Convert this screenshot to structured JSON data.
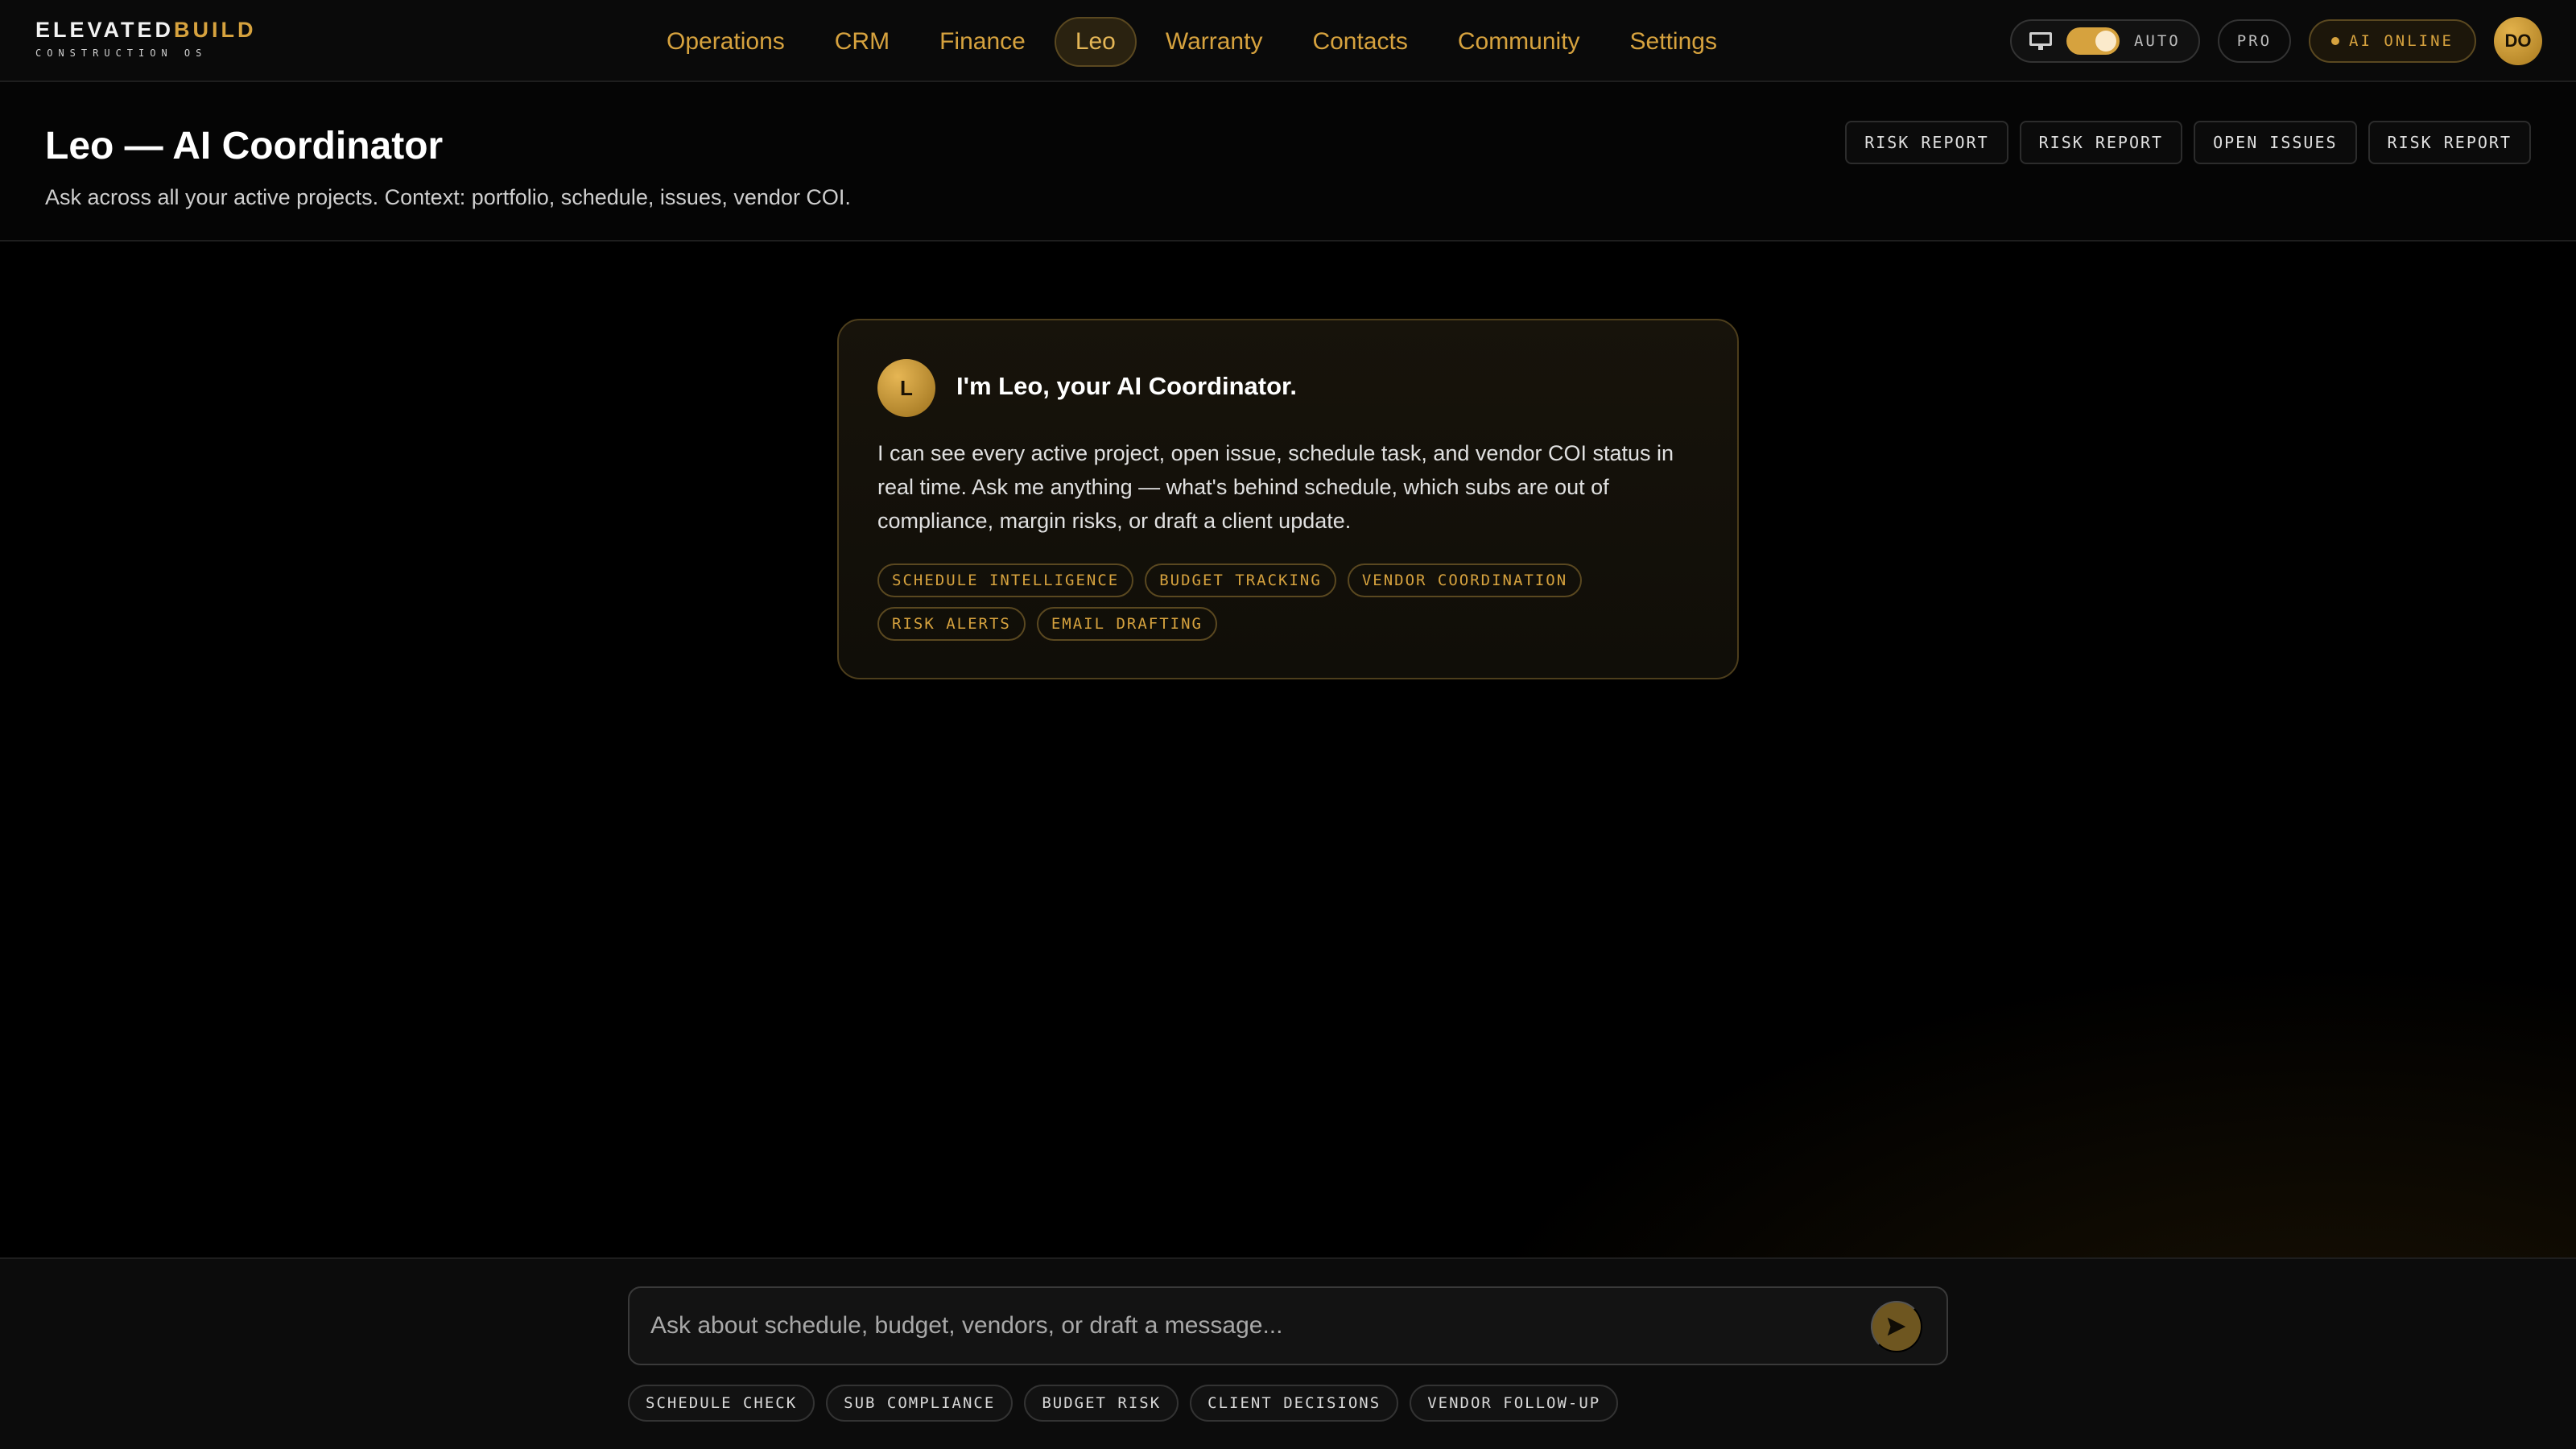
{
  "brand": {
    "name_part1": "ELEVATED",
    "name_part2": "BUILD",
    "tagline": "CONSTRUCTION OS",
    "accent_color": "#d6a23e"
  },
  "nav": {
    "items": [
      {
        "label": "Operations",
        "active": false
      },
      {
        "label": "CRM",
        "active": false
      },
      {
        "label": "Finance",
        "active": false
      },
      {
        "label": "Leo",
        "active": true
      },
      {
        "label": "Warranty",
        "active": false
      },
      {
        "label": "Contacts",
        "active": false
      },
      {
        "label": "Community",
        "active": false
      },
      {
        "label": "Settings",
        "active": false
      }
    ]
  },
  "controls": {
    "mode_icon": "monitor-icon",
    "mode_toggle_on": true,
    "mode_label": "AUTO",
    "plan_label": "PRO",
    "ai_status": "AI ONLINE",
    "avatar_initials": "DO"
  },
  "header": {
    "title": "Leo — AI Coordinator",
    "subtitle": "Ask across all your active projects. Context: portfolio, schedule, issues, vendor COI.",
    "actions": [
      "RISK REPORT",
      "RISK REPORT",
      "OPEN ISSUES",
      "RISK REPORT"
    ]
  },
  "welcome": {
    "avatar_letter": "L",
    "title": "I'm Leo, your AI Coordinator.",
    "body": "I can see every active project, open issue, schedule task, and vendor COI status in real time. Ask me anything — what's behind schedule, which subs are out of compliance, margin risks, or draft a client update.",
    "capabilities": [
      "SCHEDULE INTELLIGENCE",
      "BUDGET TRACKING",
      "VENDOR COORDINATION",
      "RISK ALERTS",
      "EMAIL DRAFTING"
    ]
  },
  "composer": {
    "placeholder": "Ask about schedule, budget, vendors, or draft a message...",
    "value": "",
    "send_icon": "send-icon",
    "quick_prompts": [
      "SCHEDULE CHECK",
      "SUB COMPLIANCE",
      "BUDGET RISK",
      "CLIENT DECISIONS",
      "VENDOR FOLLOW-UP"
    ]
  }
}
